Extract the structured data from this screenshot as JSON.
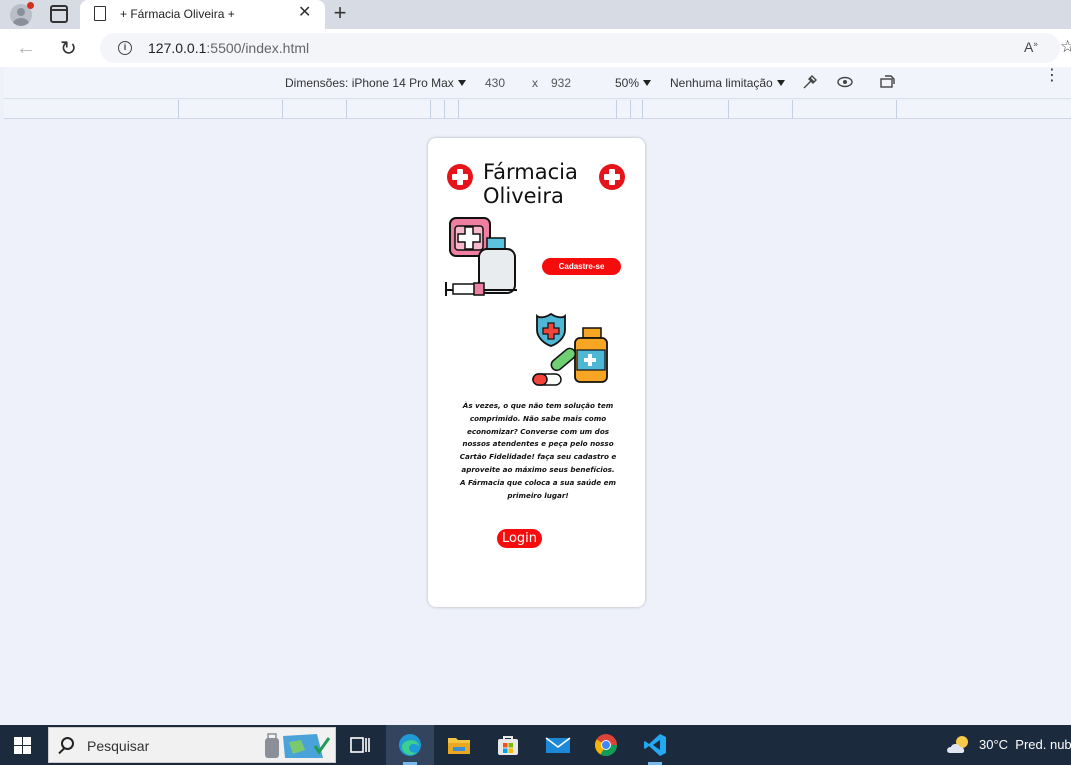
{
  "browser": {
    "tab_title": "+ Fármacia Oliveira +",
    "url_host": "127.0.0.1",
    "url_rest": ":5500/index.html"
  },
  "devtools": {
    "dimensions_label": "Dimensões: iPhone 14 Pro Max",
    "width": "430",
    "times": "x",
    "height": "932",
    "zoom": "50%",
    "throttling": "Nenhuma limitação"
  },
  "page": {
    "brand_line1": "Fármacia",
    "brand_line2": "Oliveira",
    "signup_label": "Cadastre-se",
    "message": "Às vezes, o que não tem solução tem comprimido. Não sabe mais como economizar? Converse com um dos nossos atendentes e peça pelo nosso Cartão Fidelidade! faça seu cadastro e aproveite ao máximo seus benefícios. A Fármacia que coloca a sua saúde em primeiro lugar!",
    "login_label": "Login"
  },
  "taskbar": {
    "search_placeholder": "Pesquisar",
    "weather_temp": "30°C",
    "weather_desc": "Pred. nub"
  },
  "colors": {
    "accent_red": "#f50d0d",
    "taskbar_bg": "#1c2a3d"
  }
}
